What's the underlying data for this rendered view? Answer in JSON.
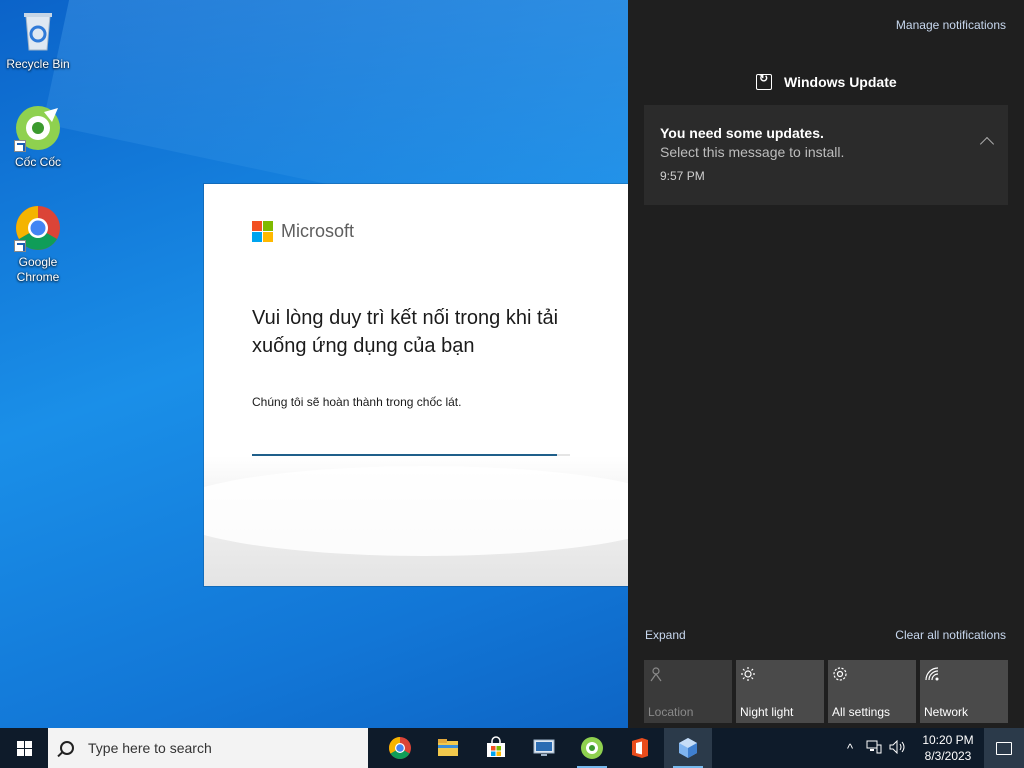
{
  "desktop": {
    "icons": [
      {
        "label": "Recycle Bin",
        "icon": "recycle-bin-icon"
      },
      {
        "label": "Cốc Cốc",
        "icon": "coccoc-icon"
      },
      {
        "label": "Google Chrome",
        "icon": "chrome-icon"
      }
    ]
  },
  "installer": {
    "brand": "Microsoft",
    "heading": "Vui lòng duy trì kết nối trong khi tải xuống ứng dụng của bạn",
    "subtext": "Chúng tôi sẽ hoàn thành trong chốc lát.",
    "progress": 0.96
  },
  "action_center": {
    "manage_label": "Manage notifications",
    "app_name": "Windows Update",
    "notification": {
      "title": "You need some updates.",
      "message": "Select this message to install.",
      "time": "9:57 PM"
    },
    "expand_label": "Expand",
    "clear_label": "Clear all notifications",
    "tiles": [
      {
        "label": "Location",
        "icon": "location-icon",
        "disabled": true
      },
      {
        "label": "Night light",
        "icon": "brightness-icon",
        "disabled": false
      },
      {
        "label": "All settings",
        "icon": "gear-icon",
        "disabled": false
      },
      {
        "label": "Network",
        "icon": "network-icon",
        "disabled": false
      }
    ]
  },
  "taskbar": {
    "search_placeholder": "Type here to search",
    "apps": [
      "chrome-icon",
      "file-explorer-icon",
      "microsoft-store-icon",
      "remote-desktop-icon",
      "coccoc-icon",
      "office-icon",
      "app-installer-icon"
    ],
    "clock_time": "10:20 PM",
    "clock_date": "8/3/2023"
  },
  "colors": {
    "accent": "#1f5f8a",
    "action_center_bg": "#1f1f1f",
    "taskbar_bg": "#0e1b2a"
  }
}
